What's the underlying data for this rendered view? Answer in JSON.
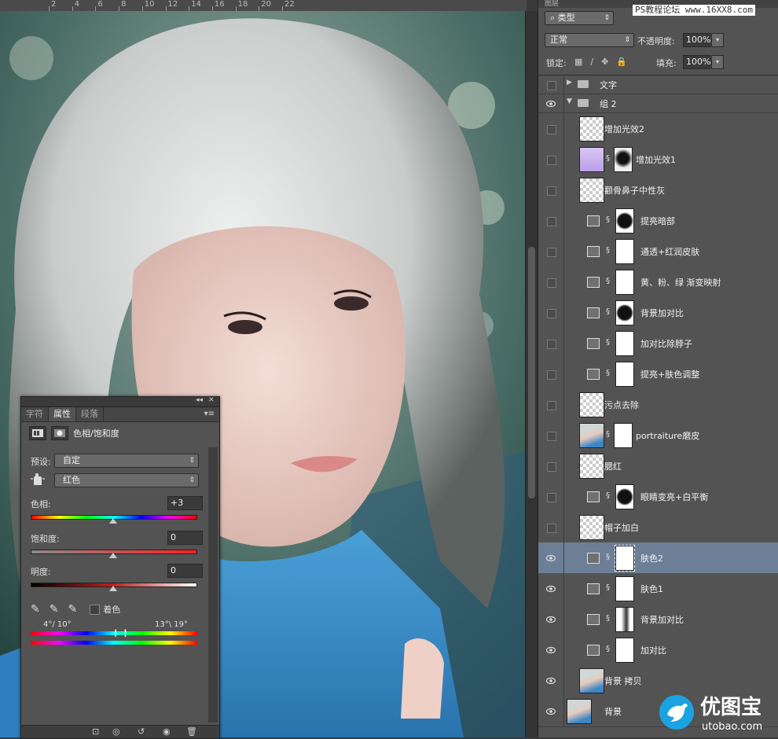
{
  "ruler": {
    "ticks": [
      "2",
      "4",
      "6",
      "8",
      "10",
      "12",
      "14",
      "16",
      "18",
      "20",
      "22"
    ]
  },
  "properties": {
    "tabs": [
      "字符",
      "属性",
      "段落"
    ],
    "active_tab": "属性",
    "title": "色相/饱和度",
    "preset_label": "预设:",
    "preset_value": "自定",
    "channel_value": "红色",
    "hue_label": "色相:",
    "hue_value": "+3",
    "hue_level": 0.5,
    "saturation_label": "饱和度:",
    "saturation_value": "0",
    "lightness_label": "明度:",
    "lightness_value": "0",
    "colorize_label": "着色",
    "range_left": "4°/ 10°",
    "range_right": "13°\\ 19°"
  },
  "layers_panel": {
    "header": "图层",
    "filter_label": "类型",
    "watermark": "PS教程论坛 www.16XX8.com",
    "blend_mode": "正常",
    "opacity_label": "不透明度:",
    "opacity_value": "100%",
    "lock_label": "锁定:",
    "fill_label": "填充:",
    "fill_value": "100%",
    "groups": [
      {
        "name": "文字",
        "visible": false,
        "expanded": false
      },
      {
        "name": "组 2",
        "visible": true,
        "expanded": true
      }
    ],
    "layers": [
      {
        "name": "增加光效2",
        "visible": false,
        "kind": "pixel"
      },
      {
        "name": "增加光效1",
        "visible": false,
        "kind": "pixel-mask"
      },
      {
        "name": "颧骨鼻子中性灰",
        "visible": false,
        "kind": "pixel"
      },
      {
        "name": "提亮暗部",
        "visible": false,
        "kind": "curves"
      },
      {
        "name": "通透+红润皮肤",
        "visible": false,
        "kind": "channel"
      },
      {
        "name": "黄、粉、绿 渐变映射",
        "visible": false,
        "kind": "gradient"
      },
      {
        "name": "背景加对比",
        "visible": false,
        "kind": "curves"
      },
      {
        "name": "加对比除脖子",
        "visible": false,
        "kind": "curves"
      },
      {
        "name": "提亮+肤色调整",
        "visible": false,
        "kind": "curves"
      },
      {
        "name": "污点去除",
        "visible": false,
        "kind": "pixel"
      },
      {
        "name": "portraiture磨皮",
        "visible": false,
        "kind": "photo-mask"
      },
      {
        "name": "腮红",
        "visible": false,
        "kind": "pixel"
      },
      {
        "name": "眼睛变亮+白平衡",
        "visible": false,
        "kind": "curves"
      },
      {
        "name": "帽子加白",
        "visible": false,
        "kind": "pixel"
      },
      {
        "name": "肤色2",
        "visible": true,
        "kind": "hsl",
        "selected": true
      },
      {
        "name": "肤色1",
        "visible": true,
        "kind": "hsl"
      },
      {
        "name": "背景加对比",
        "visible": true,
        "kind": "levels"
      },
      {
        "name": "加对比",
        "visible": true,
        "kind": "levels"
      },
      {
        "name": "背景 拷贝",
        "visible": true,
        "kind": "photo"
      },
      {
        "name": "背景",
        "visible": true,
        "kind": "photo"
      }
    ]
  },
  "logo": {
    "text": "优图宝",
    "url_text": "utobao.com"
  },
  "colors": {
    "panel": "#535353",
    "selected": "#6d7f96",
    "accent": "#1aa3e0"
  }
}
